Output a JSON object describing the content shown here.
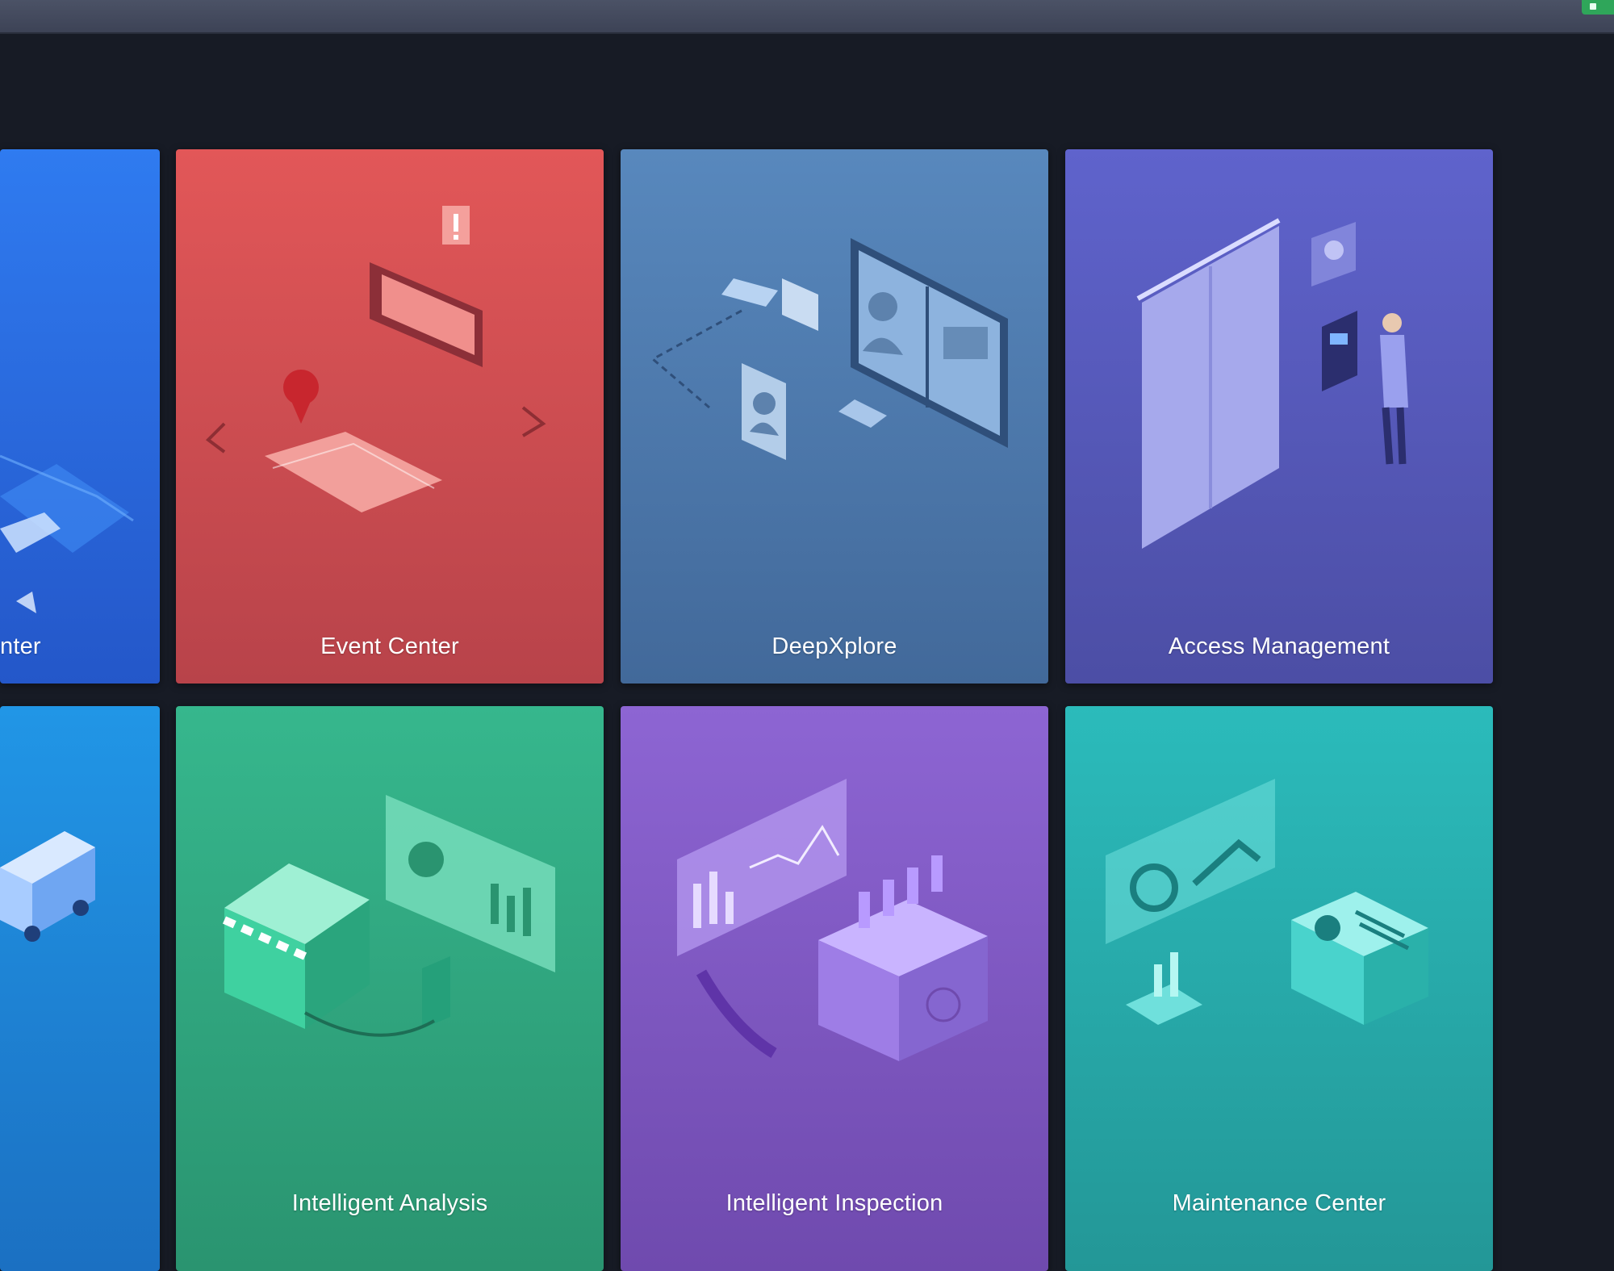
{
  "window": {
    "top_bar": ""
  },
  "tiles": [
    {
      "label": "nter",
      "color_top": "#2f7bf0",
      "color_bottom": "#2457c9",
      "icon": "location-map-icon"
    },
    {
      "label": "Event Center",
      "color_top": "#e25758",
      "color_bottom": "#b8434a",
      "icon": "event-alert-map-icon"
    },
    {
      "label": "DeepXplore",
      "color_top": "#5888bd",
      "color_bottom": "#42699a",
      "icon": "face-vehicle-search-icon"
    },
    {
      "label": "Access Management",
      "color_top": "#5f63cc",
      "color_bottom": "#4c4ea5",
      "icon": "door-access-control-icon"
    },
    {
      "label": "",
      "color_top": "#2196e6",
      "color_bottom": "#1b70c2",
      "icon": "vehicle-van-icon"
    },
    {
      "label": "Intelligent Analysis",
      "color_top": "#36b78d",
      "color_bottom": "#2a9470",
      "icon": "store-analytics-icon"
    },
    {
      "label": "Intelligent Inspection",
      "color_top": "#8d65d3",
      "color_bottom": "#6f4aae",
      "icon": "power-inspection-icon"
    },
    {
      "label": "Maintenance Center",
      "color_top": "#2bbbbb",
      "color_bottom": "#239797",
      "icon": "maintenance-dashboard-icon"
    }
  ],
  "status": {
    "corner_badge": ""
  }
}
